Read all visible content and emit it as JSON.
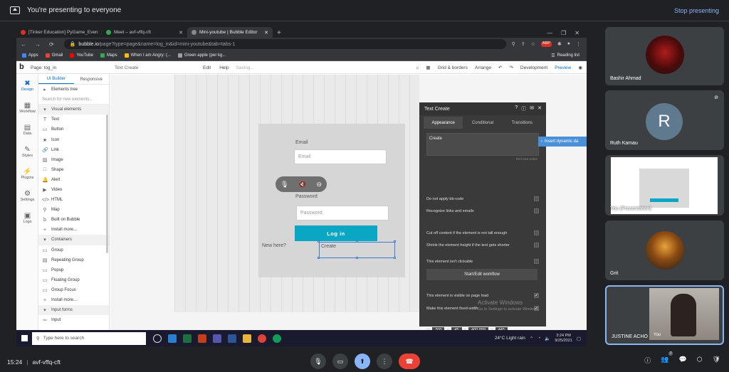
{
  "meet": {
    "presenting_text": "You're presenting to everyone",
    "stop_presenting": "Stop presenting",
    "meeting_time": "15:24",
    "meeting_code": "avf-vffq-cft",
    "participants": [
      {
        "name": "Bashir Ahmad"
      },
      {
        "name": "Ruth Kamau",
        "initial": "R"
      },
      {
        "name": "You (Presentation)"
      },
      {
        "name": "Grit"
      },
      {
        "name": "JUSTINE ACHO",
        "self_label": "You"
      }
    ],
    "badge_count": "7"
  },
  "browser": {
    "tabs": [
      {
        "label": "[Tinker Education] PyGame_Even",
        "color": "#d93025"
      },
      {
        "label": "Meet – avf-vffq-cft",
        "color": "#34a853"
      },
      {
        "label": "Mini-youtube | Bubble Editor",
        "color": "#444444",
        "active": true
      }
    ],
    "url_host": "bubble.io",
    "url_path": "/page?type=page&name=log_in&id=mini-youtube&tab=tabs-1",
    "bookmarks": [
      {
        "label": "Apps",
        "color": "#4285f4"
      },
      {
        "label": "Gmail",
        "color": "#ea4335"
      },
      {
        "label": "YouTube",
        "color": "#ff0000"
      },
      {
        "label": "Maps",
        "color": "#34a853"
      },
      {
        "label": "When I am Angry: (...",
        "color": "#fbbc05"
      },
      {
        "label": "Green apple (per kg...",
        "color": "#9aa0a6"
      }
    ],
    "reading_list": "Reading list"
  },
  "editor": {
    "page_select": "Page: log_in",
    "element_select": "Text Create",
    "menu_edit": "Edit",
    "menu_help": "Help",
    "saving": "Saving...",
    "grid_borders": "Grid & borders",
    "arrange": "Arrange",
    "development": "Development",
    "preview": "Preview",
    "sidebar": [
      {
        "label": "Design",
        "glyph": "✖"
      },
      {
        "label": "Workflow",
        "glyph": "▦"
      },
      {
        "label": "Data",
        "glyph": "▤"
      },
      {
        "label": "Styles",
        "glyph": "✎"
      },
      {
        "label": "Plugins",
        "glyph": "⚙"
      },
      {
        "label": "Settings",
        "glyph": "⚙"
      },
      {
        "label": "Logs",
        "glyph": "▣"
      }
    ],
    "panel_tabs": [
      "UI Builder",
      "Responsive"
    ],
    "elements_tree": "Elements tree",
    "search_placeholder": "Search for new elements...",
    "sections": {
      "visual": "Visual elements",
      "containers": "Containers",
      "input_forms": "Input forms"
    },
    "visual_items": [
      {
        "label": "Text",
        "glyph": "T"
      },
      {
        "label": "Button",
        "glyph": "▭"
      },
      {
        "label": "Icon",
        "glyph": "★"
      },
      {
        "label": "Link",
        "glyph": "🔗"
      },
      {
        "label": "Image",
        "glyph": "▨"
      },
      {
        "label": "Shape",
        "glyph": "□"
      },
      {
        "label": "Alert",
        "glyph": "🔔"
      },
      {
        "label": "Video",
        "glyph": "▶"
      },
      {
        "label": "HTML",
        "glyph": "</>"
      },
      {
        "label": "Map",
        "glyph": "⚲"
      },
      {
        "label": "Built on Bubble",
        "glyph": "b"
      },
      {
        "label": "Install more...",
        "glyph": "+"
      }
    ],
    "container_items": [
      {
        "label": "Group",
        "glyph": "▭"
      },
      {
        "label": "Repeating Group",
        "glyph": "▤"
      },
      {
        "label": "Popup",
        "glyph": "▭"
      },
      {
        "label": "Floating Group",
        "glyph": "▭"
      },
      {
        "label": "Group Focus",
        "glyph": "▭"
      },
      {
        "label": "Install more...",
        "glyph": "+"
      }
    ],
    "input_items": [
      {
        "label": "Input",
        "glyph": "⇦"
      }
    ],
    "canvas": {
      "email_label": "Email",
      "email_placeholder": "Email",
      "password_label": "Password",
      "password_placeholder": "Password",
      "login_button": "Log in",
      "new_here": "New here?",
      "create_text": "Create"
    },
    "property_editor": {
      "title": "Text Create",
      "tabs": [
        "Appearance",
        "Conditional",
        "Transitions"
      ],
      "content": "Create",
      "rich_text_caption": "Rich text editor",
      "insert_dynamic": "Insert dynamic da",
      "options": [
        {
          "label": "Do not apply bb-code",
          "checked": false
        },
        {
          "label": "Recognize links and emails",
          "checked": false
        },
        {
          "label": "Cut off content if the element is not tall enough",
          "checked": false
        },
        {
          "label": "Shrink the element height if the text gets shorter",
          "checked": false
        },
        {
          "label": "This element isn't clickable",
          "checked": false
        },
        {
          "label": "This element is visible on page load",
          "checked": true
        },
        {
          "label": "Make this element fixed-width",
          "checked": true
        }
      ],
      "workflow_button": "Start/Edit workflow",
      "dims": {
        "w_label": "W",
        "w": "200",
        "h_label": "H",
        "h": "45",
        "x_label": "X",
        "x": "400.899",
        "y_label": "Y",
        "y": "445"
      }
    },
    "activate": {
      "title": "Activate Windows",
      "sub": "Go to Settings to activate Windows."
    }
  },
  "taskbar": {
    "search": "Type here to search",
    "weather": "24°C  Light rain",
    "time": "3:24 PM",
    "date": "9/25/2021"
  }
}
